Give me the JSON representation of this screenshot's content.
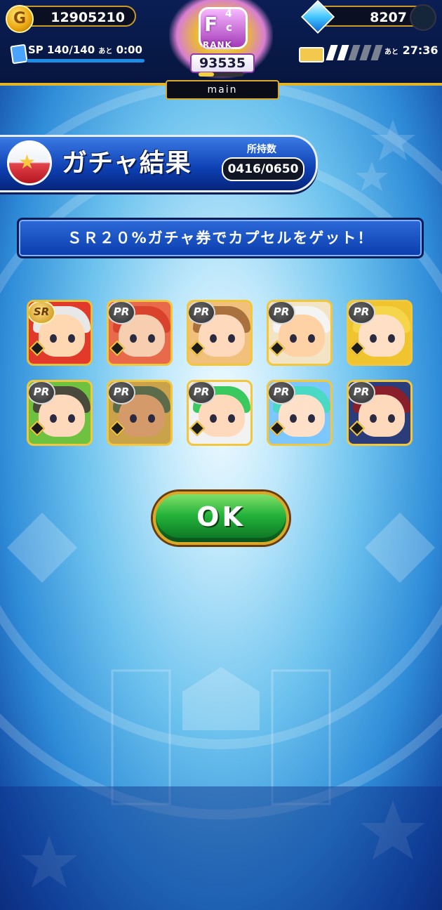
{
  "hud": {
    "coins": "12905210",
    "coin_icon_glyph": "G",
    "gems": "8207",
    "sp_label": "SP",
    "sp_value": "140/140",
    "sp_after": "あと",
    "sp_timer": "0:00",
    "stamina_after": "あと",
    "stamina_timer": "27:36",
    "stamina_bars": {
      "filled": 2,
      "total": 5
    },
    "rank": {
      "letter": "F",
      "superscript": "4",
      "subscript": "c",
      "label": "RANK",
      "value": "93535",
      "progress": 0.35
    },
    "tab_label": "main"
  },
  "banner": {
    "title": "ガチャ結果",
    "stock_label": "所持数",
    "stock_value": "0416/0650"
  },
  "message": "ＳＲ２０%ガチャ券でカプセルをゲット！",
  "cards": [
    {
      "rarity": "SR",
      "hair": "#e8e8e8",
      "bg": "#e23a2a",
      "skin": "#ffd7b0"
    },
    {
      "rarity": "PR",
      "hair": "#d9432d",
      "bg": "#e86a4a",
      "skin": "#f7ceb0"
    },
    {
      "rarity": "PR",
      "hair": "#a9713e",
      "bg": "#f1c07a",
      "skin": "#ffd9bc"
    },
    {
      "rarity": "PR",
      "hair": "#f4f4f4",
      "bg": "#f2e4c4",
      "skin": "#ffd2a6"
    },
    {
      "rarity": "PR",
      "hair": "#f5d64a",
      "bg": "#f0c42e",
      "skin": "#ffe0c4"
    },
    {
      "rarity": "PR",
      "hair": "#4a4a3c",
      "bg": "#6ec240",
      "skin": "#ffd9bc"
    },
    {
      "rarity": "PR",
      "hair": "#5c6b4a",
      "bg": "#c9a24a",
      "skin": "#d49a6a"
    },
    {
      "rarity": "PR",
      "hair": "#3ac95e",
      "bg": "#f2f2f2",
      "skin": "#ffd9bc"
    },
    {
      "rarity": "PR",
      "hair": "#4ad9c4",
      "bg": "#7cc7ff",
      "skin": "#ffe0c8"
    },
    {
      "rarity": "PR",
      "hair": "#8a1e2a",
      "bg": "#2a3c7a",
      "skin": "#ffd9bc"
    }
  ],
  "ok_button": "OK",
  "colors": {
    "gold_frame": "#f4c73a",
    "banner_blue": "#0d3fb2",
    "ok_green": "#23b23a"
  }
}
